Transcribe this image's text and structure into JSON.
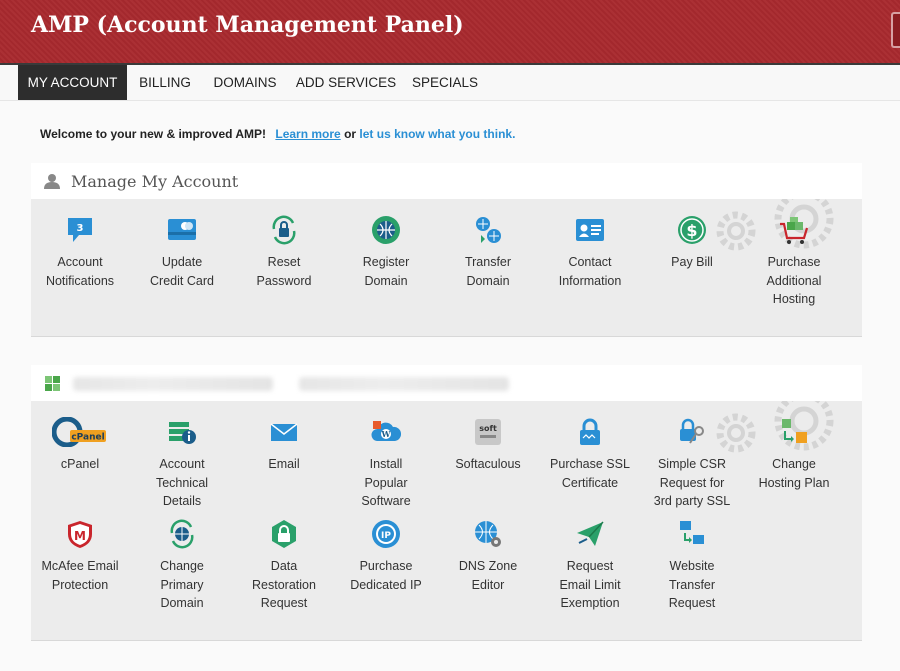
{
  "header": {
    "title": "AMP (Account Management Panel)"
  },
  "nav": {
    "tabs": [
      {
        "label": "MY ACCOUNT"
      },
      {
        "label": "BILLING"
      },
      {
        "label": "DOMAINS"
      },
      {
        "label": "ADD SERVICES"
      },
      {
        "label": "SPECIALS"
      }
    ]
  },
  "welcome": {
    "text": "Welcome to your new & improved AMP!",
    "learn_more": "Learn more",
    "or": " or ",
    "feedback": "let us know what you think."
  },
  "manage": {
    "title": "Manage My Account",
    "notification_count": "3",
    "items": [
      {
        "label": "Account\nNotifications"
      },
      {
        "label": "Update\nCredit Card"
      },
      {
        "label": "Reset\nPassword"
      },
      {
        "label": "Register\nDomain"
      },
      {
        "label": "Transfer\nDomain"
      },
      {
        "label": "Contact\nInformation"
      },
      {
        "label": "Pay Bill"
      },
      {
        "label": "Purchase\nAdditional\nHosting"
      }
    ]
  },
  "hosting": {
    "icons": {
      "cpanel_text": "cPanel",
      "softaculous_text": "soft",
      "mcafee_text": "M",
      "ip_text": "IP"
    },
    "items": [
      {
        "label": "cPanel"
      },
      {
        "label": "Account\nTechnical\nDetails"
      },
      {
        "label": "Email"
      },
      {
        "label": "Install\nPopular\nSoftware"
      },
      {
        "label": "Softaculous"
      },
      {
        "label": "Purchase SSL\nCertificate"
      },
      {
        "label": "Simple CSR\nRequest for\n3rd party SSL"
      },
      {
        "label": "Change\nHosting Plan"
      },
      {
        "label": "McAfee Email\nProtection"
      },
      {
        "label": "Change\nPrimary\nDomain"
      },
      {
        "label": "Data\nRestoration\nRequest"
      },
      {
        "label": "Purchase\nDedicated IP"
      },
      {
        "label": "DNS Zone\nEditor"
      },
      {
        "label": "Request\nEmail Limit\nExemption"
      },
      {
        "label": "Website\nTransfer\nRequest"
      }
    ]
  }
}
